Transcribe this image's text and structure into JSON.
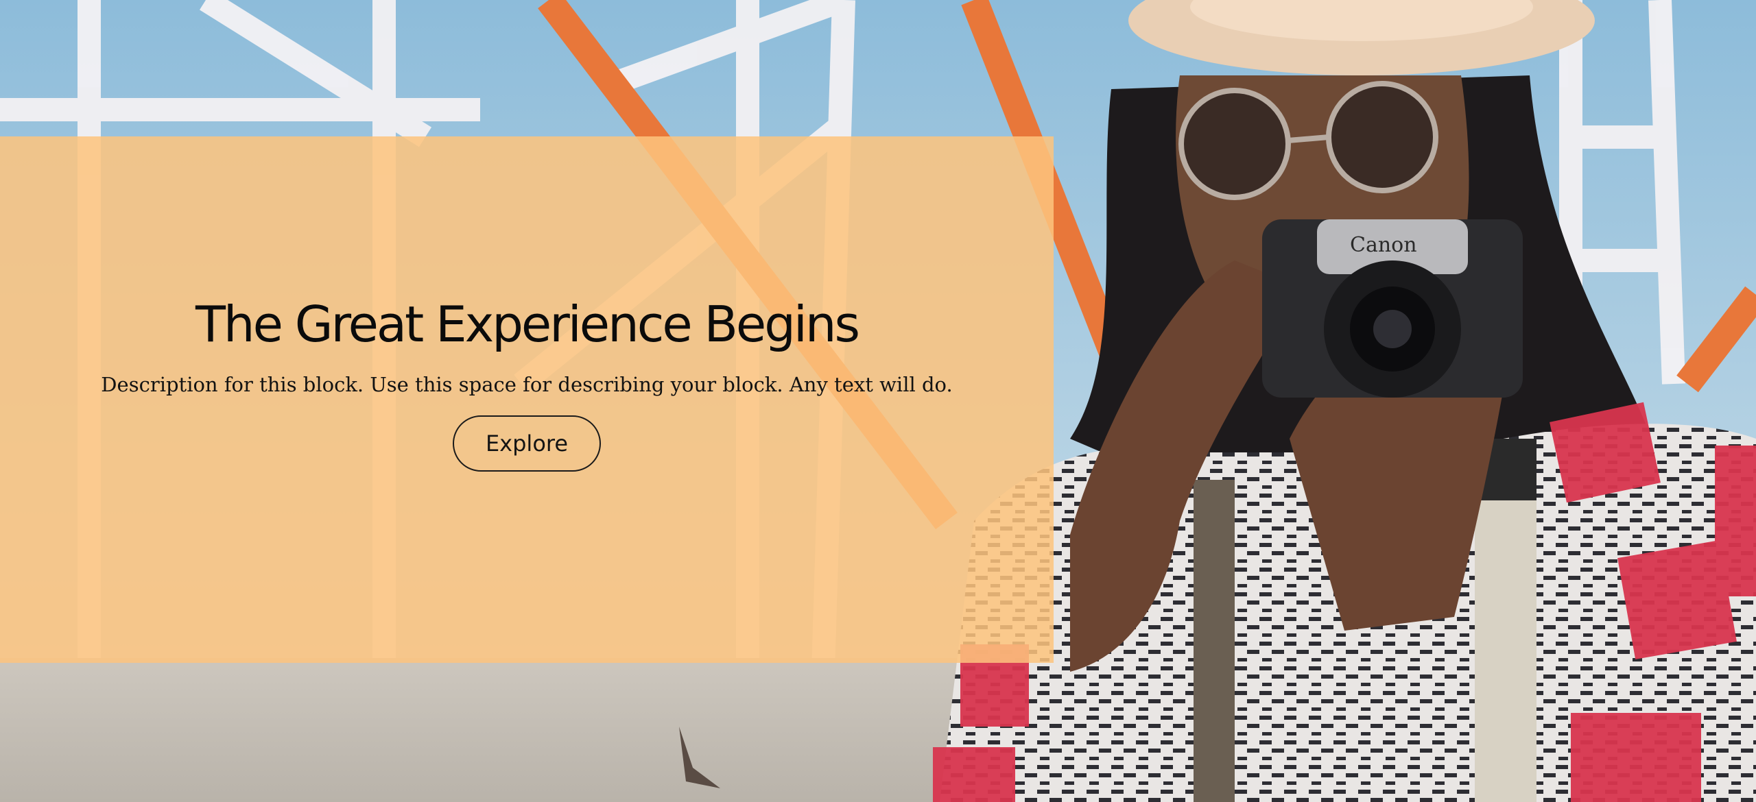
{
  "hero": {
    "title": "The Great Experience Begins",
    "description": "Description for this block. Use this space for describing your block. Any text will do.",
    "button_label": "Explore"
  },
  "colors": {
    "panel": "#fdc47e",
    "sky": "#9ec3dc",
    "shirt_red": "#d8354e",
    "coaster_orange": "#e8773a"
  },
  "background": {
    "subject": "man-with-camera-photo",
    "camera_brand_text": "Canon"
  }
}
